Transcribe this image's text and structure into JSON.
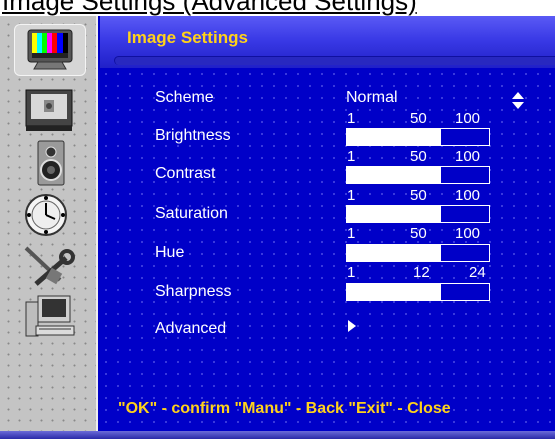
{
  "page_heading": "Image Settings (Advanced Settings)",
  "menu": {
    "title": "Image Settings",
    "footer_hint": "\"OK\" - confirm \"Manu\" - Back \"Exit\" - Close"
  },
  "sidebar": {
    "icons": [
      {
        "name": "color-bars-monitor-icon",
        "active": true
      },
      {
        "name": "screen-display-icon",
        "active": false
      },
      {
        "name": "speaker-icon",
        "active": false
      },
      {
        "name": "clock-icon",
        "active": false
      },
      {
        "name": "wrench-tools-icon",
        "active": false
      },
      {
        "name": "computer-icon",
        "active": false
      }
    ]
  },
  "settings": {
    "scheme": {
      "label": "Scheme",
      "value": "Normal"
    },
    "brightness": {
      "label": "Brightness",
      "scale": [
        "1",
        "50",
        "100"
      ],
      "level": 0.66
    },
    "contrast": {
      "label": "Contrast",
      "scale": [
        "1",
        "50",
        "100"
      ],
      "level": 0.66
    },
    "saturation": {
      "label": "Saturation",
      "scale": [
        "1",
        "50",
        "100"
      ],
      "level": 0.66
    },
    "hue": {
      "label": "Hue",
      "scale": [
        "1",
        "50",
        "100"
      ],
      "level": 0.66
    },
    "sharpness": {
      "label": "Sharpness",
      "scale": [
        "1",
        "12",
        "24"
      ],
      "level": 0.66
    },
    "advanced": {
      "label": "Advanced"
    }
  },
  "colors": {
    "background": "#0000c8",
    "title_yellow": "#ffd21a",
    "text": "#ffffff",
    "sidebar": "#c4c4c4"
  }
}
